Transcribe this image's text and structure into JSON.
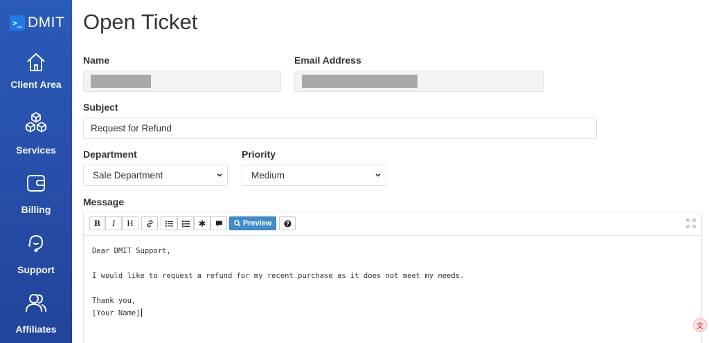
{
  "brand": {
    "badge": ">_",
    "name": "DMIT",
    "accent_color": "#1f7ae8"
  },
  "sidebar": {
    "background_color": "#2a5bb8",
    "items": [
      {
        "label": "Client Area",
        "icon": "home-icon"
      },
      {
        "label": "Services",
        "icon": "cubes-icon"
      },
      {
        "label": "Billing",
        "icon": "wallet-icon"
      },
      {
        "label": "Support",
        "icon": "headset-icon"
      },
      {
        "label": "Affiliates",
        "icon": "users-icon"
      }
    ]
  },
  "page": {
    "title": "Open Ticket"
  },
  "form": {
    "name_label": "Name",
    "email_label": "Email Address",
    "subject_label": "Subject",
    "subject_value": "Request for Refund",
    "department_label": "Department",
    "department_value": "Sale Department",
    "priority_label": "Priority",
    "priority_value": "Medium",
    "message_label": "Message"
  },
  "editor": {
    "toolbar": {
      "bold": "B",
      "italic": "I",
      "heading": "H",
      "preview": "Preview",
      "preview_color": "#428bca"
    },
    "lines": [
      "Dear DMIT Support,",
      "",
      "I would like to request a refund for my recent purchase as it does not meet my needs.",
      "",
      "Thank you,",
      "[Your Name]"
    ]
  }
}
